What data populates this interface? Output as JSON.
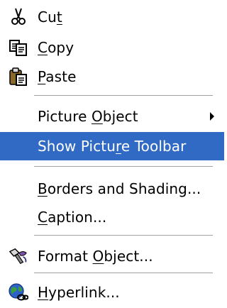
{
  "menu": {
    "items": [
      {
        "pre": "Cu",
        "key": "t",
        "post": "",
        "icon": "scissors-icon"
      },
      {
        "pre": "",
        "key": "C",
        "post": "opy",
        "icon": "copy-icon"
      },
      {
        "pre": "",
        "key": "P",
        "post": "aste",
        "icon": "paste-icon"
      },
      {
        "pre": "Picture ",
        "key": "O",
        "post": "bject",
        "submenu": true
      },
      {
        "pre": "Show Pictu",
        "key": "r",
        "post": "e Toolbar",
        "highlighted": true
      },
      {
        "pre": "",
        "key": "B",
        "post": "orders and Shading...",
        "icon": ""
      },
      {
        "pre": "",
        "key": "C",
        "post": "aption...",
        "icon": ""
      },
      {
        "pre": "Format ",
        "key": "O",
        "post": "bject...",
        "icon": "format-object-icon"
      },
      {
        "pre": "",
        "key": "H",
        "post": "yperlink...",
        "icon": "hyperlink-globe-icon"
      }
    ],
    "colors": {
      "highlight_bg": "#316ac5",
      "highlight_fg": "#ffffff",
      "separator": "#a0a0a0"
    }
  }
}
